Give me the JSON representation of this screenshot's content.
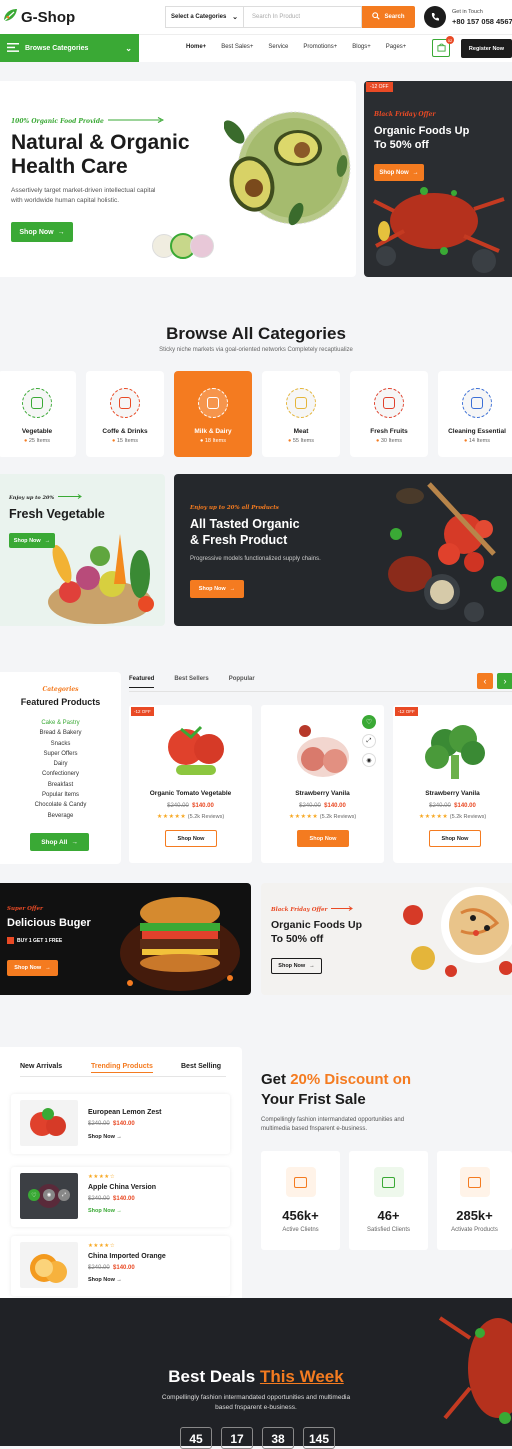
{
  "brand": {
    "name": "G-Shop"
  },
  "header": {
    "category_select": "Select a Categories",
    "search_placeholder": "Search In Product",
    "search_button": "Search",
    "contact_label": "Get in Touch",
    "contact_phone": "+80 157 058 4567"
  },
  "nav": {
    "browse": "Browse Categories",
    "items": [
      "Home+",
      "Best Sales+",
      "Service",
      "Promotions+",
      "Blogs+",
      "Pages+"
    ],
    "cart_count": "02",
    "register": "Register Now"
  },
  "hero": {
    "tagline": "100% Organic Food Provide",
    "title_line1": "Natural & Organic",
    "title_line2": "Health Care",
    "desc_line1": "Assertively target market-driven intellectual capital",
    "desc_line2": "with worldwide human capital holistic.",
    "button": "Shop Now"
  },
  "hero_promo": {
    "badge": "-12 OFF",
    "tagline": "Black Friday Offer",
    "title_line1": "Organic Foods Up",
    "title_line2": "To 50% off",
    "button": "Shop Now"
  },
  "categories": {
    "title": "Browse All Categories",
    "subtitle": "Sticky niche markets via goal-oriented networks Completely recaptiualize",
    "items": [
      {
        "name": "Vegetable",
        "count": "25 Items",
        "active": false
      },
      {
        "name": "Coffe & Drinks",
        "count": "15 Items",
        "active": false
      },
      {
        "name": "Milk & Dairy",
        "count": "18 Items",
        "active": true
      },
      {
        "name": "Meat",
        "count": "55 Items",
        "active": false
      },
      {
        "name": "Fresh Fruits",
        "count": "30 Items",
        "active": false
      },
      {
        "name": "Cleaning Essential",
        "count": "14 Items",
        "active": false
      }
    ]
  },
  "banner_veg": {
    "tagline": "Enjoy up to 20%",
    "title": "Fresh Vegetable",
    "button": "Shop Now"
  },
  "banner_organic": {
    "tagline": "Enjoy up to 20% all Products",
    "title_line1": "All Tasted Organic",
    "title_line2": "& Fresh Product",
    "desc": "Progressive models functionalized supply chains.",
    "button": "Shop Now"
  },
  "featured": {
    "label": "Categories",
    "title": "Featured Products",
    "list": [
      "Cake & Pastry",
      "Bread & Bakery",
      "Snacks",
      "Super Offers",
      "Dairy",
      "Confectionery",
      "Breakfast",
      "Popular Items",
      "Chocolate & Candy",
      "Beverage"
    ],
    "button": "Shop All",
    "tabs": [
      "Featured",
      "Best Sellers",
      "Poppular"
    ],
    "products": [
      {
        "badge": "-12 OFF",
        "name": "Organic Tomato Vegetable",
        "old": "$240.00",
        "price": "$140.00",
        "rating": "★★★★★",
        "reviews": "(5.2k Reviews)",
        "button": "Shop Now"
      },
      {
        "badge": "",
        "name": "Strawberry Vanila",
        "old": "$240.00",
        "price": "$140.00",
        "rating": "★★★★★",
        "reviews": "(5.2k Reviews)",
        "button": "Shop Now"
      },
      {
        "badge": "-12 OFF",
        "name": "Strawberry Vanila",
        "old": "$240.00",
        "price": "$140.00",
        "rating": "★★★★★",
        "reviews": "(5.2k Reviews)",
        "button": "Shop Now"
      }
    ]
  },
  "promo_burger": {
    "tagline": "Super Offer",
    "title": "Delicious Buger",
    "sub": "BUY 1 GET 1 FREE",
    "button": "Shop Now"
  },
  "promo_organic": {
    "tagline": "Black Friday Offer",
    "title_line1": "Organic Foods Up",
    "title_line2": "To 50% off",
    "button": "Shop Now"
  },
  "trending": {
    "tabs": [
      "New Arrivals",
      "Trending Products",
      "Best Selling"
    ],
    "items": [
      {
        "rating": "",
        "name": "European Lemon Zest",
        "old": "$240.00",
        "price": "$140.00",
        "link": "Shop Now"
      },
      {
        "rating": "★★★★☆",
        "name": "Apple China  Version",
        "old": "$240.00",
        "price": "$140.00",
        "link": "Shop Now"
      },
      {
        "rating": "★★★★☆",
        "name": "China Imported Orange",
        "old": "$240.00",
        "price": "$140.00",
        "link": "Shop Now"
      }
    ]
  },
  "discount": {
    "title_a": "Get ",
    "title_highlight": "20% Discount on",
    "title_b": "Your Frist Sale",
    "desc_line1": "Compellingly fashion intermandated opportunities and",
    "desc_line2": "multimedia based fnsparent e-business.",
    "stats": [
      {
        "value": "456k+",
        "label": "Active Clietns"
      },
      {
        "value": "46+",
        "label": "Satisfied Clients"
      },
      {
        "value": "285k+",
        "label": "Activate Products"
      }
    ]
  },
  "deals": {
    "title_a": "Best Deals ",
    "title_highlight": "This Week",
    "desc_line1": "Compellingly fashion intermandated opportunities and multimedia",
    "desc_line2": "based fnsparent e-business.",
    "countdown": [
      "45",
      "17",
      "38",
      "145"
    ]
  },
  "colors": {
    "green": "#3aa935",
    "orange": "#f47b20",
    "dark": "#1a1a1a"
  }
}
